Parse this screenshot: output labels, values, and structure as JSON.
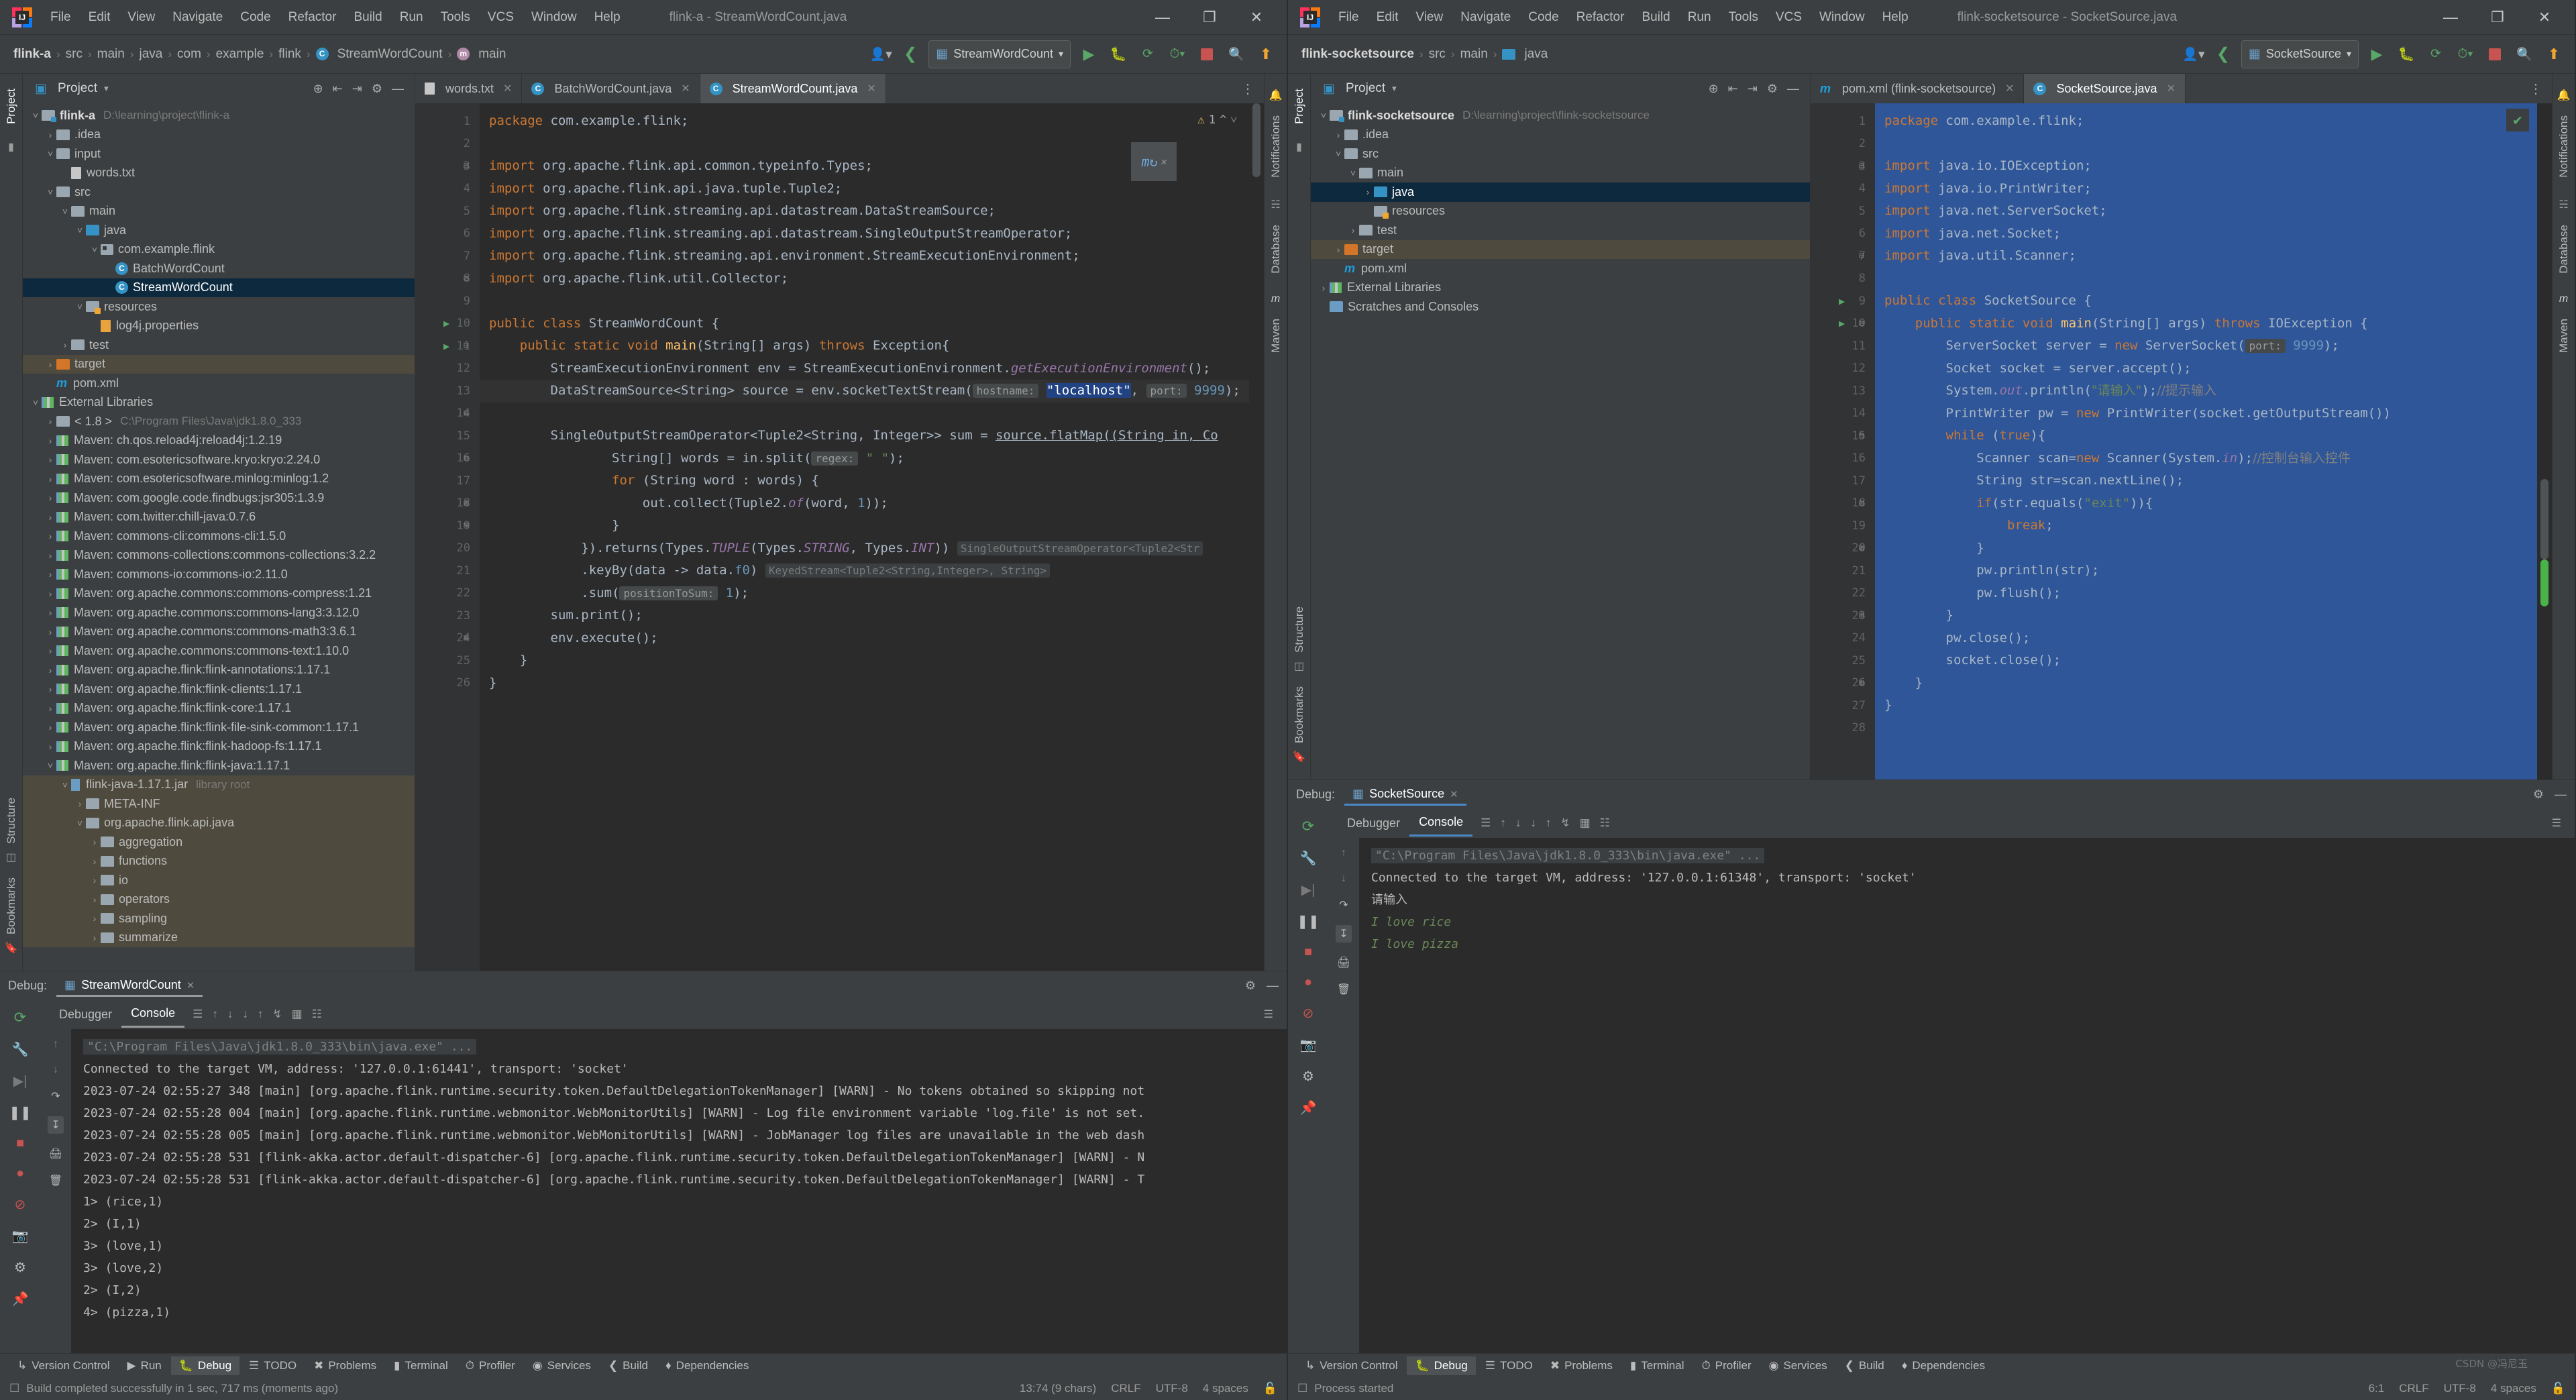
{
  "menu": [
    "File",
    "Edit",
    "View",
    "Navigate",
    "Code",
    "Refactor",
    "Build",
    "Run",
    "Tools",
    "VCS",
    "Window",
    "Help"
  ],
  "window_controls": {
    "minimize": "—",
    "maximize": "❐",
    "close": "✕"
  },
  "left": {
    "title": "flink-a - StreamWordCount.java",
    "breadcrumbs": [
      "flink-a",
      "src",
      "main",
      "java",
      "com",
      "example",
      "flink",
      "StreamWordCount",
      "main"
    ],
    "run_config": "StreamWordCount",
    "project": {
      "panel_title": "Project",
      "tree": [
        {
          "label": "flink-a",
          "path": "D:\\learning\\project\\flink-a",
          "depth": 0,
          "arrow": "v",
          "icon": "module",
          "bold": true
        },
        {
          "label": ".idea",
          "depth": 1,
          "arrow": ">",
          "icon": "folder"
        },
        {
          "label": "input",
          "depth": 1,
          "arrow": "v",
          "icon": "folder"
        },
        {
          "label": "words.txt",
          "depth": 2,
          "arrow": "",
          "icon": "text"
        },
        {
          "label": "src",
          "depth": 1,
          "arrow": "v",
          "icon": "folder"
        },
        {
          "label": "main",
          "depth": 2,
          "arrow": "v",
          "icon": "folder"
        },
        {
          "label": "java",
          "depth": 3,
          "arrow": "v",
          "icon": "folder-blue"
        },
        {
          "label": "com.example.flink",
          "depth": 4,
          "arrow": "v",
          "icon": "package"
        },
        {
          "label": "BatchWordCount",
          "depth": 5,
          "arrow": "",
          "icon": "class"
        },
        {
          "label": "StreamWordCount",
          "depth": 5,
          "arrow": "",
          "icon": "class",
          "state": "selected"
        },
        {
          "label": "resources",
          "depth": 3,
          "arrow": "v",
          "icon": "folder-res"
        },
        {
          "label": "log4j.properties",
          "depth": 4,
          "arrow": "",
          "icon": "props"
        },
        {
          "label": "test",
          "depth": 2,
          "arrow": ">",
          "icon": "folder"
        },
        {
          "label": "target",
          "depth": 1,
          "arrow": ">",
          "icon": "folder-orange",
          "state": "highlight"
        },
        {
          "label": "pom.xml",
          "depth": 1,
          "arrow": "",
          "icon": "maven"
        },
        {
          "label": "External Libraries",
          "depth": 0,
          "arrow": "v",
          "icon": "libs"
        },
        {
          "label": "< 1.8 >",
          "path": "C:\\Program Files\\Java\\jdk1.8.0_333",
          "depth": 1,
          "arrow": ">",
          "icon": "jdk"
        },
        {
          "label": "Maven: ch.qos.reload4j:reload4j:1.2.19",
          "depth": 1,
          "arrow": ">",
          "icon": "lib"
        },
        {
          "label": "Maven: com.esotericsoftware.kryo:kryo:2.24.0",
          "depth": 1,
          "arrow": ">",
          "icon": "lib"
        },
        {
          "label": "Maven: com.esotericsoftware.minlog:minlog:1.2",
          "depth": 1,
          "arrow": ">",
          "icon": "lib"
        },
        {
          "label": "Maven: com.google.code.findbugs:jsr305:1.3.9",
          "depth": 1,
          "arrow": ">",
          "icon": "lib"
        },
        {
          "label": "Maven: com.twitter:chill-java:0.7.6",
          "depth": 1,
          "arrow": ">",
          "icon": "lib"
        },
        {
          "label": "Maven: commons-cli:commons-cli:1.5.0",
          "depth": 1,
          "arrow": ">",
          "icon": "lib"
        },
        {
          "label": "Maven: commons-collections:commons-collections:3.2.2",
          "depth": 1,
          "arrow": ">",
          "icon": "lib"
        },
        {
          "label": "Maven: commons-io:commons-io:2.11.0",
          "depth": 1,
          "arrow": ">",
          "icon": "lib"
        },
        {
          "label": "Maven: org.apache.commons:commons-compress:1.21",
          "depth": 1,
          "arrow": ">",
          "icon": "lib"
        },
        {
          "label": "Maven: org.apache.commons:commons-lang3:3.12.0",
          "depth": 1,
          "arrow": ">",
          "icon": "lib"
        },
        {
          "label": "Maven: org.apache.commons:commons-math3:3.6.1",
          "depth": 1,
          "arrow": ">",
          "icon": "lib"
        },
        {
          "label": "Maven: org.apache.commons:commons-text:1.10.0",
          "depth": 1,
          "arrow": ">",
          "icon": "lib"
        },
        {
          "label": "Maven: org.apache.flink:flink-annotations:1.17.1",
          "depth": 1,
          "arrow": ">",
          "icon": "lib"
        },
        {
          "label": "Maven: org.apache.flink:flink-clients:1.17.1",
          "depth": 1,
          "arrow": ">",
          "icon": "lib"
        },
        {
          "label": "Maven: org.apache.flink:flink-core:1.17.1",
          "depth": 1,
          "arrow": ">",
          "icon": "lib"
        },
        {
          "label": "Maven: org.apache.flink:flink-file-sink-common:1.17.1",
          "depth": 1,
          "arrow": ">",
          "icon": "lib"
        },
        {
          "label": "Maven: org.apache.flink:flink-hadoop-fs:1.17.1",
          "depth": 1,
          "arrow": ">",
          "icon": "lib"
        },
        {
          "label": "Maven: org.apache.flink:flink-java:1.17.1",
          "depth": 1,
          "arrow": "v",
          "icon": "lib"
        },
        {
          "label": "flink-java-1.17.1.jar",
          "path": "library root",
          "depth": 2,
          "arrow": "v",
          "icon": "jar",
          "state": "highlight"
        },
        {
          "label": "META-INF",
          "depth": 3,
          "arrow": ">",
          "icon": "folder",
          "state": "highlight"
        },
        {
          "label": "org.apache.flink.api.java",
          "depth": 3,
          "arrow": "v",
          "icon": "folder",
          "state": "highlight"
        },
        {
          "label": "aggregation",
          "depth": 4,
          "arrow": ">",
          "icon": "folder",
          "state": "highlight"
        },
        {
          "label": "functions",
          "depth": 4,
          "arrow": ">",
          "icon": "folder",
          "state": "highlight"
        },
        {
          "label": "io",
          "depth": 4,
          "arrow": ">",
          "icon": "folder",
          "state": "highlight"
        },
        {
          "label": "operators",
          "depth": 4,
          "arrow": ">",
          "icon": "folder",
          "state": "highlight"
        },
        {
          "label": "sampling",
          "depth": 4,
          "arrow": ">",
          "icon": "folder",
          "state": "highlight"
        },
        {
          "label": "summarize",
          "depth": 4,
          "arrow": ">",
          "icon": "folder",
          "state": "highlight"
        }
      ]
    },
    "tabs": [
      {
        "label": "words.txt",
        "icon": "text-file-icon",
        "active": false
      },
      {
        "label": "BatchWordCount.java",
        "icon": "java-class-icon",
        "active": false
      },
      {
        "label": "StreamWordCount.java",
        "icon": "java-class-icon",
        "active": true
      }
    ],
    "warning_count": "1",
    "code_lines": [
      {
        "n": 1,
        "run": false,
        "fold": ""
      },
      {
        "n": 2,
        "run": false,
        "fold": ""
      },
      {
        "n": 3,
        "run": false,
        "fold": "-"
      },
      {
        "n": 4,
        "run": false,
        "fold": ""
      },
      {
        "n": 5,
        "run": false,
        "fold": ""
      },
      {
        "n": 6,
        "run": false,
        "fold": ""
      },
      {
        "n": 7,
        "run": false,
        "fold": ""
      },
      {
        "n": 8,
        "run": false,
        "fold": "-"
      },
      {
        "n": 9,
        "run": false,
        "fold": ""
      },
      {
        "n": 10,
        "run": true,
        "fold": ""
      },
      {
        "n": 11,
        "run": true,
        "fold": "-"
      },
      {
        "n": 12,
        "run": false,
        "fold": ""
      },
      {
        "n": 13,
        "run": false,
        "fold": ""
      },
      {
        "n": 14,
        "run": false,
        "fold": "-"
      },
      {
        "n": 15,
        "run": false,
        "fold": ""
      },
      {
        "n": 16,
        "run": false,
        "fold": "-"
      },
      {
        "n": 17,
        "run": false,
        "fold": ""
      },
      {
        "n": 18,
        "run": false,
        "fold": "+"
      },
      {
        "n": 19,
        "run": false,
        "fold": "+"
      },
      {
        "n": 20,
        "run": false,
        "fold": ""
      },
      {
        "n": 21,
        "run": false,
        "fold": ""
      },
      {
        "n": 22,
        "run": false,
        "fold": ""
      },
      {
        "n": 23,
        "run": false,
        "fold": ""
      },
      {
        "n": 24,
        "run": false,
        "fold": "+"
      },
      {
        "n": 25,
        "run": false,
        "fold": ""
      },
      {
        "n": 26,
        "run": false,
        "fold": ""
      }
    ],
    "debug": {
      "label": "Debug:",
      "session": "StreamWordCount",
      "tabs": [
        "Debugger",
        "Console"
      ],
      "active_tab": "Console",
      "console": [
        "\"C:\\Program Files\\Java\\jdk1.8.0_333\\bin\\java.exe\" ...",
        "Connected to the target VM, address: '127.0.0.1:61441', transport: 'socket'",
        "2023-07-24 02:55:27 348 [main] [org.apache.flink.runtime.security.token.DefaultDelegationTokenManager] [WARN] - No tokens obtained so skipping not",
        "2023-07-24 02:55:28 004 [main] [org.apache.flink.runtime.webmonitor.WebMonitorUtils] [WARN] - Log file environment variable 'log.file' is not set.",
        "2023-07-24 02:55:28 005 [main] [org.apache.flink.runtime.webmonitor.WebMonitorUtils] [WARN] - JobManager log files are unavailable in the web dash",
        "2023-07-24 02:55:28 531 [flink-akka.actor.default-dispatcher-6] [org.apache.flink.runtime.security.token.DefaultDelegationTokenManager] [WARN] - N",
        "2023-07-24 02:55:28 531 [flink-akka.actor.default-dispatcher-6] [org.apache.flink.runtime.security.token.DefaultDelegationTokenManager] [WARN] - T",
        "1> (rice,1)",
        "2> (I,1)",
        "3> (love,1)",
        "3> (love,2)",
        "2> (I,2)",
        "4> (pizza,1)"
      ]
    },
    "bottom_tools": [
      "Version Control",
      "Run",
      "Debug",
      "TODO",
      "Problems",
      "Terminal",
      "Profiler",
      "Services",
      "Build",
      "Dependencies"
    ],
    "bottom_active": "Debug",
    "status": {
      "message": "Build completed successfully in 1 sec, 717 ms (moments ago)",
      "caret": "13:74 (9 chars)",
      "line_sep": "CRLF",
      "encoding": "UTF-8",
      "indent": "4 spaces"
    },
    "side_labels": {
      "project": "Project",
      "structure": "Structure",
      "bookmarks": "Bookmarks",
      "notifications": "Notifications",
      "database": "Database",
      "maven": "Maven"
    }
  },
  "right": {
    "title": "flink-socketsource - SocketSource.java",
    "breadcrumbs": [
      "flink-socketsource",
      "src",
      "main",
      "java"
    ],
    "run_config": "SocketSource",
    "project": {
      "panel_title": "Project",
      "tree": [
        {
          "label": "flink-socketsource",
          "path": "D:\\learning\\project\\flink-socketsource",
          "depth": 0,
          "arrow": "v",
          "icon": "module",
          "bold": true
        },
        {
          "label": ".idea",
          "depth": 1,
          "arrow": ">",
          "icon": "folder"
        },
        {
          "label": "src",
          "depth": 1,
          "arrow": "v",
          "icon": "folder"
        },
        {
          "label": "main",
          "depth": 2,
          "arrow": "v",
          "icon": "folder"
        },
        {
          "label": "java",
          "depth": 3,
          "arrow": ">",
          "icon": "folder-blue",
          "state": "selected"
        },
        {
          "label": "resources",
          "depth": 3,
          "arrow": "",
          "icon": "folder-res"
        },
        {
          "label": "test",
          "depth": 2,
          "arrow": ">",
          "icon": "folder"
        },
        {
          "label": "target",
          "depth": 1,
          "arrow": ">",
          "icon": "folder-orange",
          "state": "highlight"
        },
        {
          "label": "pom.xml",
          "depth": 1,
          "arrow": "",
          "icon": "maven"
        },
        {
          "label": "External Libraries",
          "depth": 0,
          "arrow": ">",
          "icon": "libs"
        },
        {
          "label": "Scratches and Consoles",
          "depth": 0,
          "arrow": "",
          "icon": "scratch"
        }
      ]
    },
    "tabs": [
      {
        "label": "pom.xml (flink-socketsource)",
        "icon": "maven-file-icon",
        "active": false
      },
      {
        "label": "SocketSource.java",
        "icon": "java-class-icon",
        "active": true
      }
    ],
    "code_lines": [
      {
        "n": 1,
        "run": false,
        "fold": ""
      },
      {
        "n": 2,
        "run": false,
        "fold": ""
      },
      {
        "n": 3,
        "run": false,
        "fold": "-"
      },
      {
        "n": 4,
        "run": false,
        "fold": ""
      },
      {
        "n": 5,
        "run": false,
        "fold": ""
      },
      {
        "n": 6,
        "run": false,
        "fold": ""
      },
      {
        "n": 7,
        "run": false,
        "fold": "-"
      },
      {
        "n": 8,
        "run": false,
        "fold": ""
      },
      {
        "n": 9,
        "run": true,
        "fold": ""
      },
      {
        "n": 10,
        "run": true,
        "fold": "-"
      },
      {
        "n": 11,
        "run": false,
        "fold": ""
      },
      {
        "n": 12,
        "run": false,
        "fold": ""
      },
      {
        "n": 13,
        "run": false,
        "fold": ""
      },
      {
        "n": 14,
        "run": false,
        "fold": ""
      },
      {
        "n": 15,
        "run": false,
        "fold": "-"
      },
      {
        "n": 16,
        "run": false,
        "fold": ""
      },
      {
        "n": 17,
        "run": false,
        "fold": ""
      },
      {
        "n": 18,
        "run": false,
        "fold": "-"
      },
      {
        "n": 19,
        "run": false,
        "fold": ""
      },
      {
        "n": 20,
        "run": false,
        "fold": "+"
      },
      {
        "n": 21,
        "run": false,
        "fold": ""
      },
      {
        "n": 22,
        "run": false,
        "fold": ""
      },
      {
        "n": 23,
        "run": false,
        "fold": "+"
      },
      {
        "n": 24,
        "run": false,
        "fold": ""
      },
      {
        "n": 25,
        "run": false,
        "fold": ""
      },
      {
        "n": 26,
        "run": false,
        "fold": "+"
      },
      {
        "n": 27,
        "run": false,
        "fold": ""
      },
      {
        "n": 28,
        "run": false,
        "fold": ""
      }
    ],
    "debug": {
      "label": "Debug:",
      "session": "SocketSource",
      "tabs": [
        "Debugger",
        "Console"
      ],
      "active_tab": "Console",
      "console": [
        "\"C:\\Program Files\\Java\\jdk1.8.0_333\\bin\\java.exe\" ...",
        "Connected to the target VM, address: '127.0.0.1:61348', transport: 'socket'",
        "请输入",
        "I love rice",
        "I love pizza"
      ]
    },
    "bottom_tools": [
      "Version Control",
      "Debug",
      "TODO",
      "Problems",
      "Terminal",
      "Profiler",
      "Services",
      "Build",
      "Dependencies"
    ],
    "bottom_active": "Debug",
    "status": {
      "message": "Process started",
      "caret": "6:1",
      "line_sep": "CRLF",
      "encoding": "UTF-8",
      "indent": "4 spaces"
    },
    "watermark": "CSDN @冯尼玉",
    "side_labels": {
      "project": "Project",
      "structure": "Structure",
      "bookmarks": "Bookmarks",
      "notifications": "Notifications",
      "database": "Database",
      "maven": "Maven"
    }
  }
}
